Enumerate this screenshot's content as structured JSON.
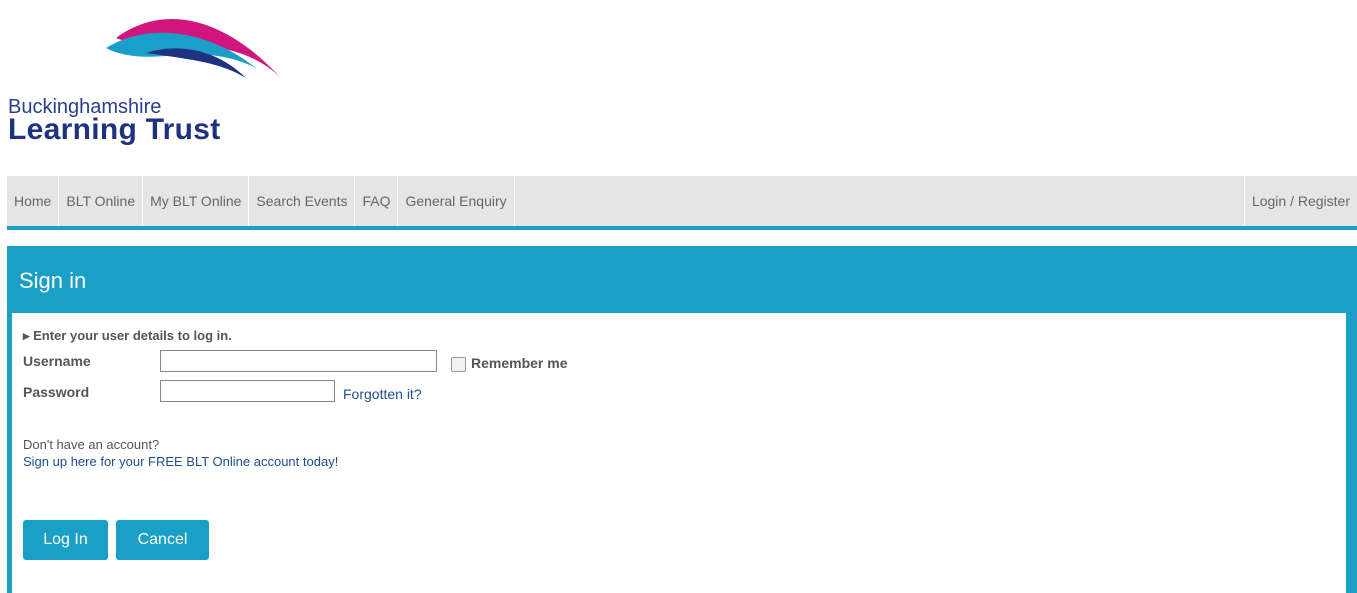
{
  "logo": {
    "line1": "Buckinghamshire",
    "line2": "Learning Trust",
    "colors": {
      "blue": "#1f3281",
      "cyan": "#1aa0c8",
      "pink": "#d2157e"
    }
  },
  "nav": {
    "items": [
      "Home",
      "BLT Online",
      "My BLT Online",
      "Search Events",
      "FAQ",
      "General Enquiry"
    ],
    "login": "Login / Register"
  },
  "signin": {
    "title": "Sign in",
    "hint": "▸ Enter your user details to log in.",
    "username_label": "Username",
    "username_value": "",
    "password_label": "Password",
    "password_value": "",
    "remember_label": "Remember me",
    "remember_checked": false,
    "forgot_link": "Forgotten it?",
    "no_account": "Don't have an account?",
    "signup_link": "Sign up here for your FREE BLT Online account today!",
    "login_button": "Log In",
    "cancel_button": "Cancel"
  },
  "theme": {
    "accent": "#1a9fc7",
    "nav_bg": "#e5e5e5"
  }
}
